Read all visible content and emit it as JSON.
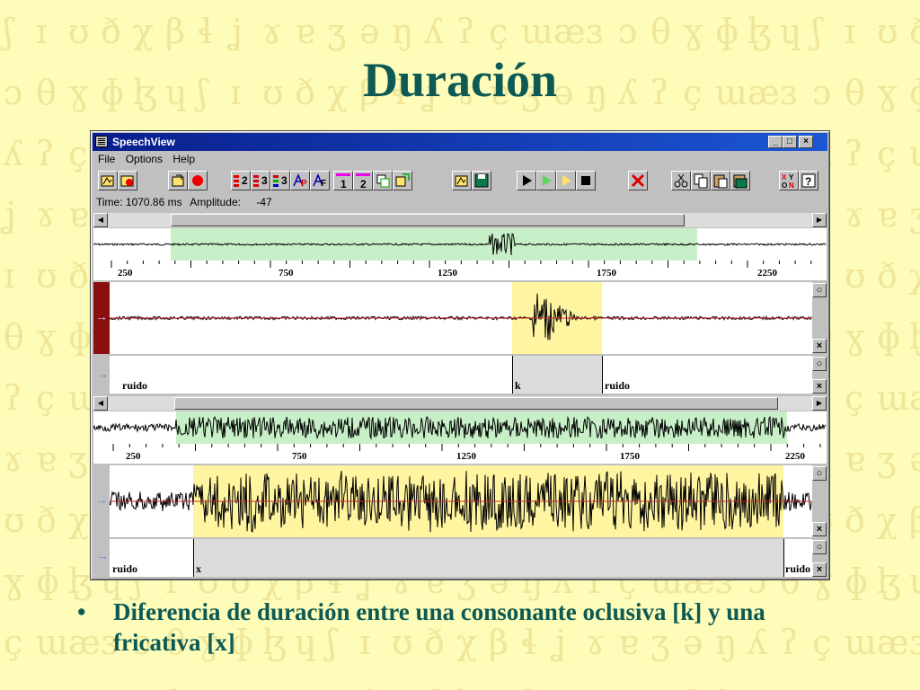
{
  "slide": {
    "title": "Duración",
    "bullet": "Diferencia de duración entre una consonante oclusiva [k] y una fricativa [x]",
    "bullet_marker": "•",
    "title_color": "#0d5a55",
    "background_color": "#fdfcb8"
  },
  "window": {
    "title": "SpeechView",
    "menu": [
      "File",
      "Options",
      "Help"
    ],
    "status": {
      "time": "Time: 1070.86 ms",
      "amplitude_label": "Amplitude:",
      "amplitude_value": "-47"
    },
    "toolbar_icons": [
      "open-file-icon",
      "record-file-icon",
      "export-icon",
      "record-icon",
      "two-channel-icon",
      "three-channel-icon",
      "three-color-channel-icon",
      "pitch-icon",
      "formant-icon",
      "marker-one-icon",
      "marker-two-icon",
      "copy-region-icon",
      "paste-region-icon",
      "open-wave-icon",
      "save-wave-icon",
      "play-icon",
      "play-selection-icon",
      "play-to-end-icon",
      "stop-icon",
      "delete-icon",
      "cut-icon",
      "copy-icon",
      "paste-icon",
      "clipboard-icon",
      "toggle-on-off-icon",
      "help-icon"
    ],
    "toolbar_labels": {
      "two": "2",
      "three": "3",
      "three_b": "3",
      "one": "1",
      "two_b": "2"
    },
    "window_buttons": {
      "minimize": "_",
      "maximize": "□",
      "close": "×"
    }
  },
  "upper_view": {
    "ticks": [
      "250",
      "750",
      "1250",
      "1750",
      "2250"
    ],
    "segments": [
      "ruido",
      "k",
      "ruido"
    ]
  },
  "lower_view": {
    "ticks": [
      "250",
      "750",
      "1250",
      "1750",
      "2250"
    ],
    "segments": [
      "ruido",
      "x",
      "ruido"
    ]
  },
  "colors": {
    "selection_green": "#c8f0c8",
    "selection_yellow": "#fff5a0",
    "waveform": "#000000",
    "baseline": "#cc2a2a",
    "channel_marker": "#8a1010"
  }
}
